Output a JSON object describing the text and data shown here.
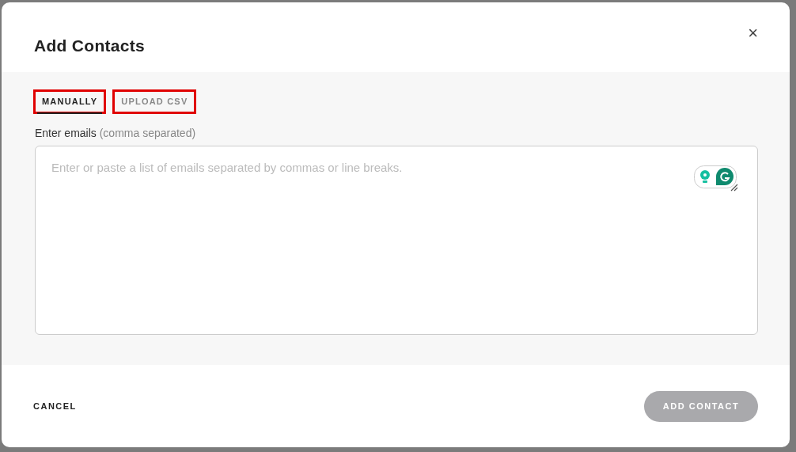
{
  "dialog": {
    "title": "Add Contacts",
    "close": "×"
  },
  "tabs": [
    {
      "label": "MANUALLY",
      "selected": true,
      "outlined": true
    },
    {
      "label": "UPLOAD CSV",
      "selected": false,
      "outlined": true
    }
  ],
  "field": {
    "label": "Enter emails",
    "hint": "(comma separated)",
    "placeholder": "Enter or paste a list of emails separated by commas or line breaks."
  },
  "buttons": [
    {
      "label": "CANCEL",
      "disabled": false
    },
    {
      "label": "ADD CONTACT",
      "disabled": true
    }
  ]
}
